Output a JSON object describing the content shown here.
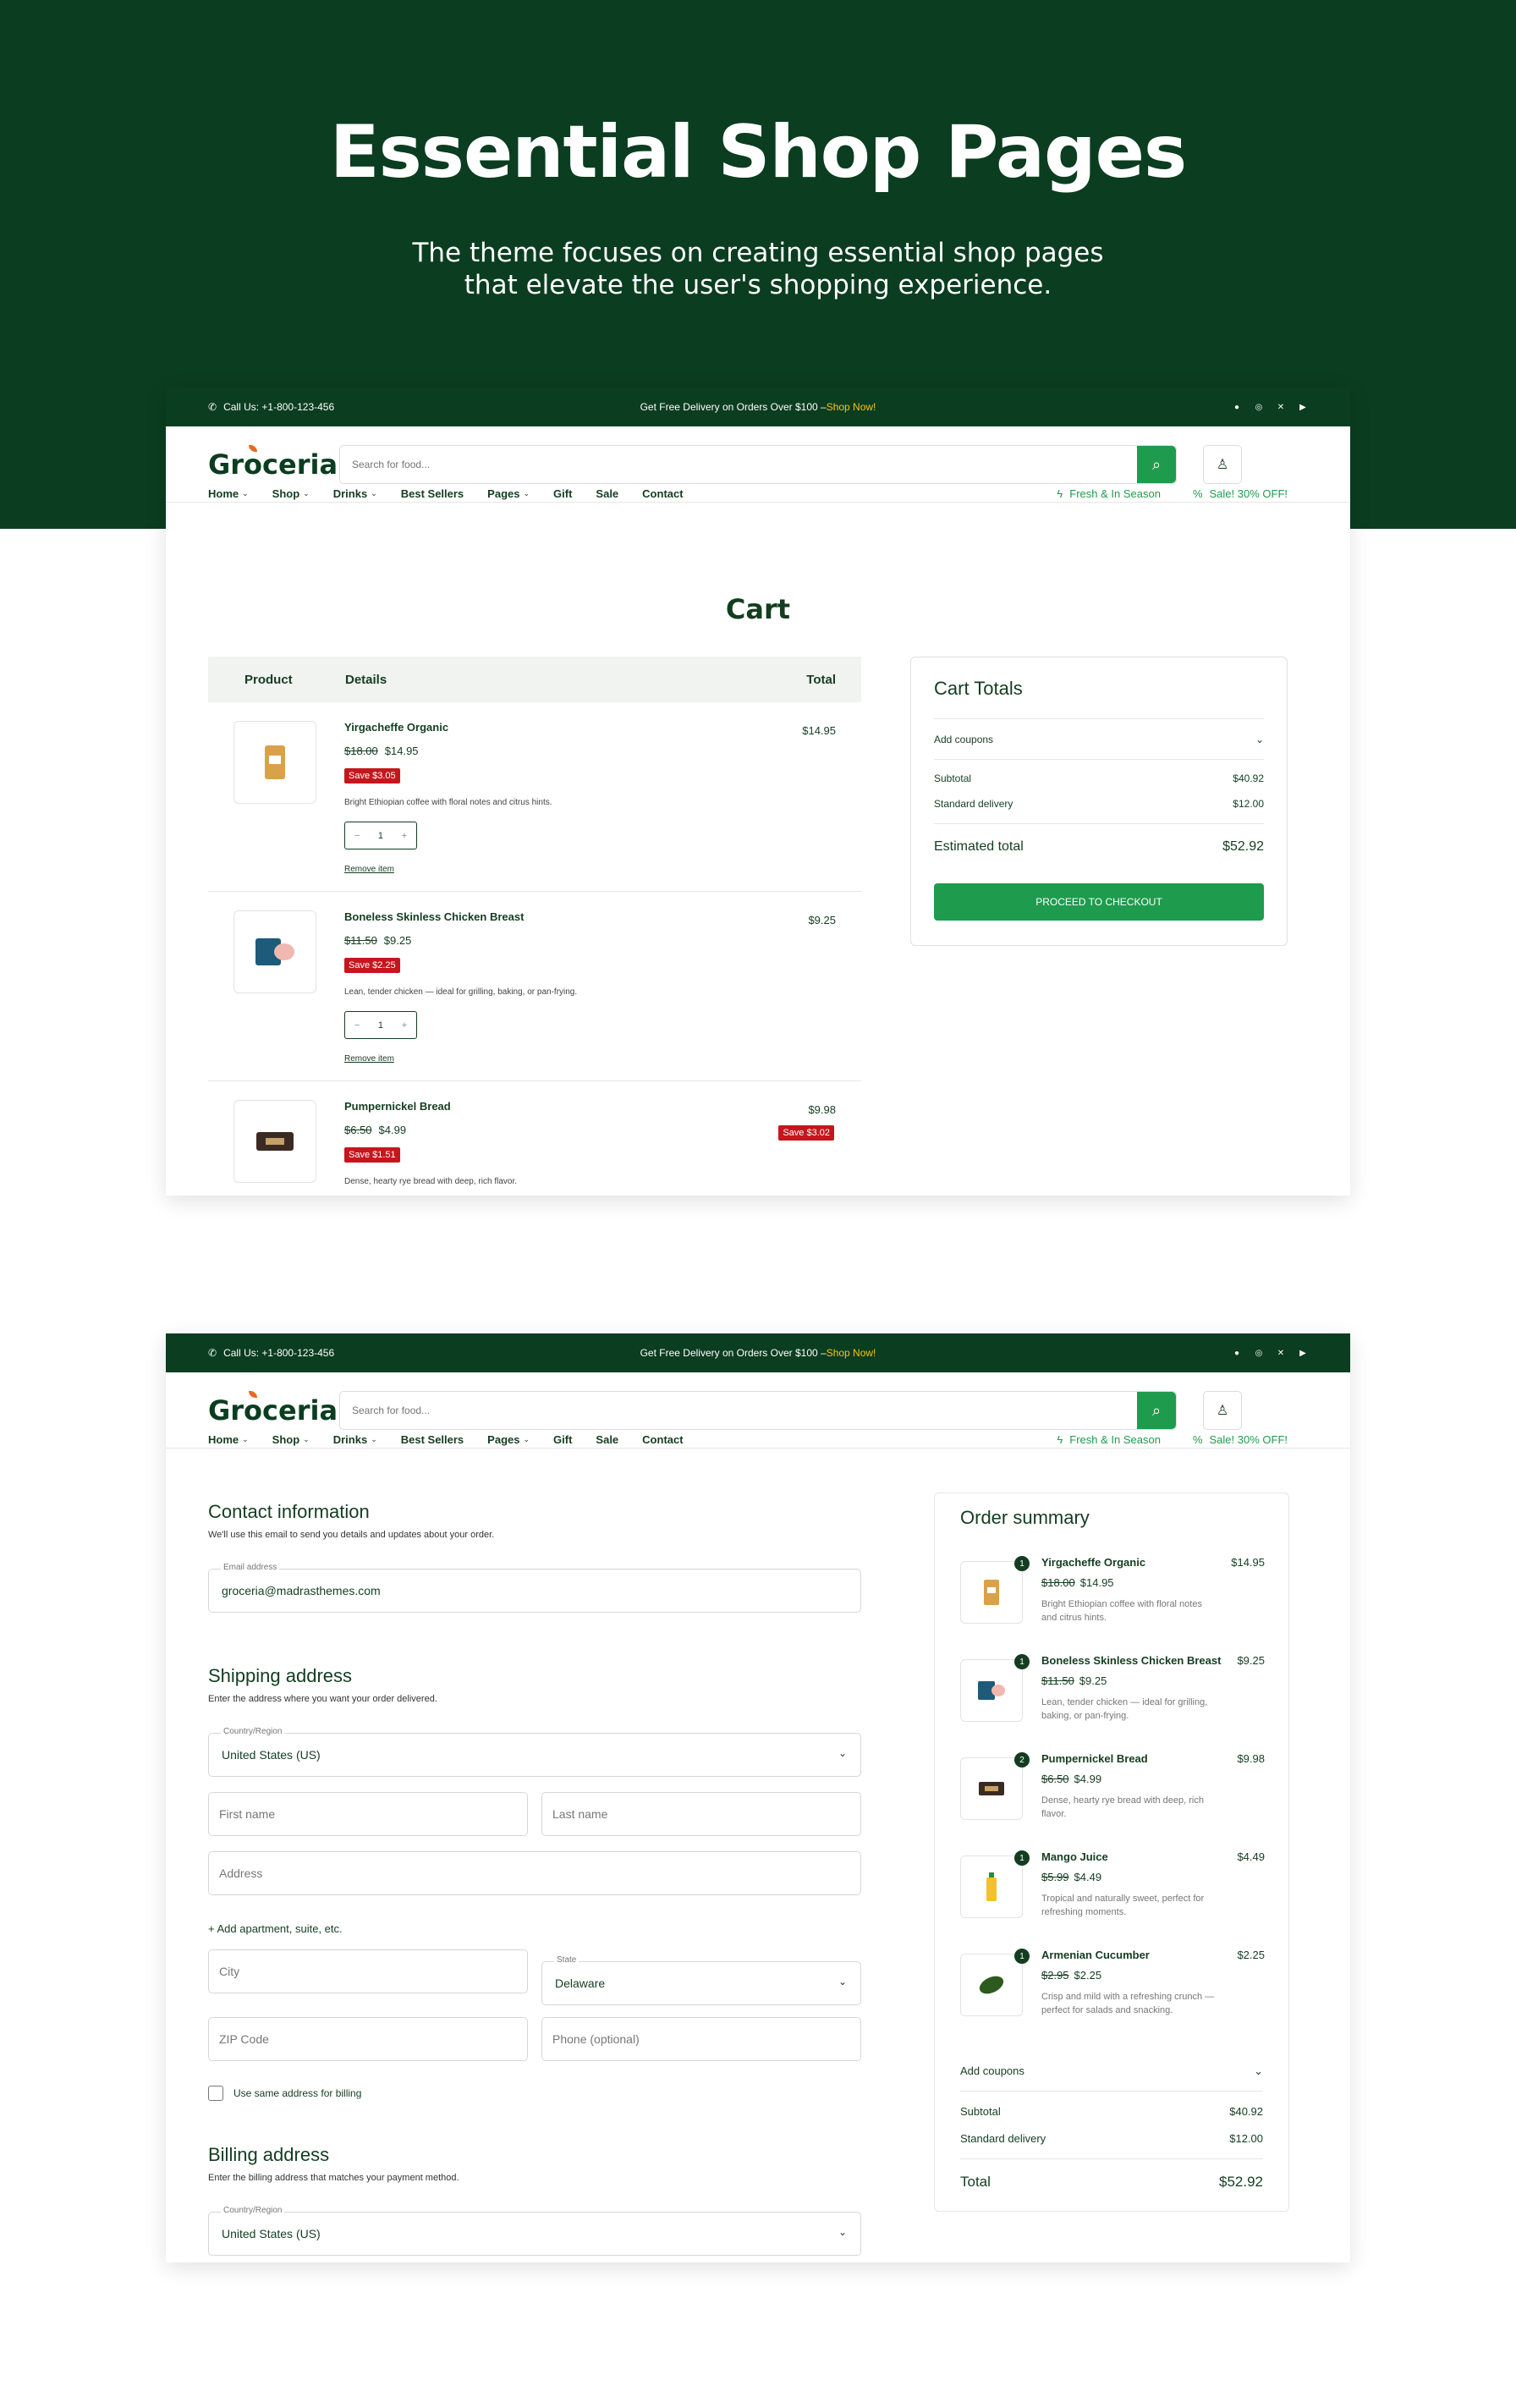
{
  "hero": {
    "title": "Essential Shop Pages",
    "subtitle_1": "The theme focuses on creating essential shop pages",
    "subtitle_2": "that elevate the user's shopping experience."
  },
  "topbar": {
    "call": "Call Us: +1-800-123-456",
    "promo": "Get Free Delivery on Orders Over $100 –",
    "promo_link": "Shop Now!",
    "social_icons": [
      "facebook-icon",
      "instagram-icon",
      "x-icon",
      "youtube-icon"
    ]
  },
  "header": {
    "logo": "Groceria",
    "search_placeholder": "Search for food...",
    "nav": [
      "Home",
      "Shop",
      "Drinks",
      "Best Sellers",
      "Pages",
      "Gift",
      "Sale",
      "Contact"
    ],
    "fresh": "Fresh & In Season",
    "sale": "Sale! 30% OFF!"
  },
  "cart": {
    "title": "Cart",
    "headers": {
      "product": "Product",
      "details": "Details",
      "total": "Total"
    },
    "items": [
      {
        "name": "Yirgacheffe Organic",
        "old": "$18.00",
        "price": "$14.95",
        "save": "Save $3.05",
        "desc": "Bright Ethiopian coffee with floral notes and citrus hints.",
        "qty": "1",
        "total": "$14.95",
        "remove": "Remove item"
      },
      {
        "name": "Boneless Skinless Chicken Breast",
        "old": "$11.50",
        "price": "$9.25",
        "save": "Save $2.25",
        "desc": "Lean, tender chicken — ideal for grilling, baking, or pan-frying.",
        "qty": "1",
        "total": "$9.25",
        "remove": "Remove item"
      },
      {
        "name": "Pumpernickel Bread",
        "old": "$6.50",
        "price": "$4.99",
        "save": "Save $1.51",
        "desc": "Dense, hearty rye bread with deep, rich flavor.",
        "total": "$9.98",
        "total_save": "Save $3.02"
      }
    ],
    "qty_minus": "−",
    "qty_plus": "+",
    "totals": {
      "title": "Cart Totals",
      "coupons": "Add coupons",
      "subtotal_label": "Subtotal",
      "subtotal": "$40.92",
      "delivery_label": "Standard delivery",
      "delivery": "$12.00",
      "estimated_label": "Estimated total",
      "estimated": "$52.92",
      "checkout": "PROCEED TO CHECKOUT"
    }
  },
  "checkout": {
    "contact_title": "Contact information",
    "contact_sub": "We'll use this email to send you details and updates about your order.",
    "email_label": "Email address",
    "email": "groceria@madrasthemes.com",
    "shipping_title": "Shipping address",
    "shipping_sub": "Enter the address where you want your order delivered.",
    "country_label": "Country/Region",
    "country": "United States (US)",
    "first": "First name",
    "last": "Last name",
    "address": "Address",
    "add_apt": "+ Add apartment, suite, etc.",
    "city": "City",
    "state_label": "State",
    "state": "Delaware",
    "zip": "ZIP Code",
    "phone": "Phone (optional)",
    "same_billing": "Use same address for billing",
    "billing_title": "Billing address",
    "billing_sub": "Enter the billing address that matches your payment method."
  },
  "summary": {
    "title": "Order summary",
    "items": [
      {
        "qty": "1",
        "name": "Yirgacheffe Organic",
        "old": "$18.00",
        "price": "$14.95",
        "desc": "Bright Ethiopian coffee with floral notes and citrus hints.",
        "total": "$14.95"
      },
      {
        "qty": "1",
        "name": "Boneless Skinless Chicken Breast",
        "old": "$11.50",
        "price": "$9.25",
        "desc": "Lean, tender chicken — ideal for grilling, baking, or pan-frying.",
        "total": "$9.25"
      },
      {
        "qty": "2",
        "name": "Pumpernickel Bread",
        "old": "$6.50",
        "price": "$4.99",
        "desc": "Dense, hearty rye bread with deep, rich flavor.",
        "total": "$9.98"
      },
      {
        "qty": "1",
        "name": "Mango Juice",
        "old": "$5.99",
        "price": "$4.49",
        "desc": "Tropical and naturally sweet, perfect for refreshing moments.",
        "total": "$4.49"
      },
      {
        "qty": "1",
        "name": "Armenian Cucumber",
        "old": "$2.95",
        "price": "$2.25",
        "desc": "Crisp and mild with a refreshing crunch — perfect for salads and snacking.",
        "total": "$2.25"
      }
    ],
    "coupons": "Add coupons",
    "subtotal_label": "Subtotal",
    "subtotal": "$40.92",
    "delivery_label": "Standard delivery",
    "delivery": "$12.00",
    "total_label": "Total",
    "total": "$52.92"
  },
  "colors": {
    "brand_dark": "#0b3d20",
    "brand_green": "#1f9b4e",
    "sale_red": "#c6161d",
    "promo_yellow": "#f5c518"
  }
}
